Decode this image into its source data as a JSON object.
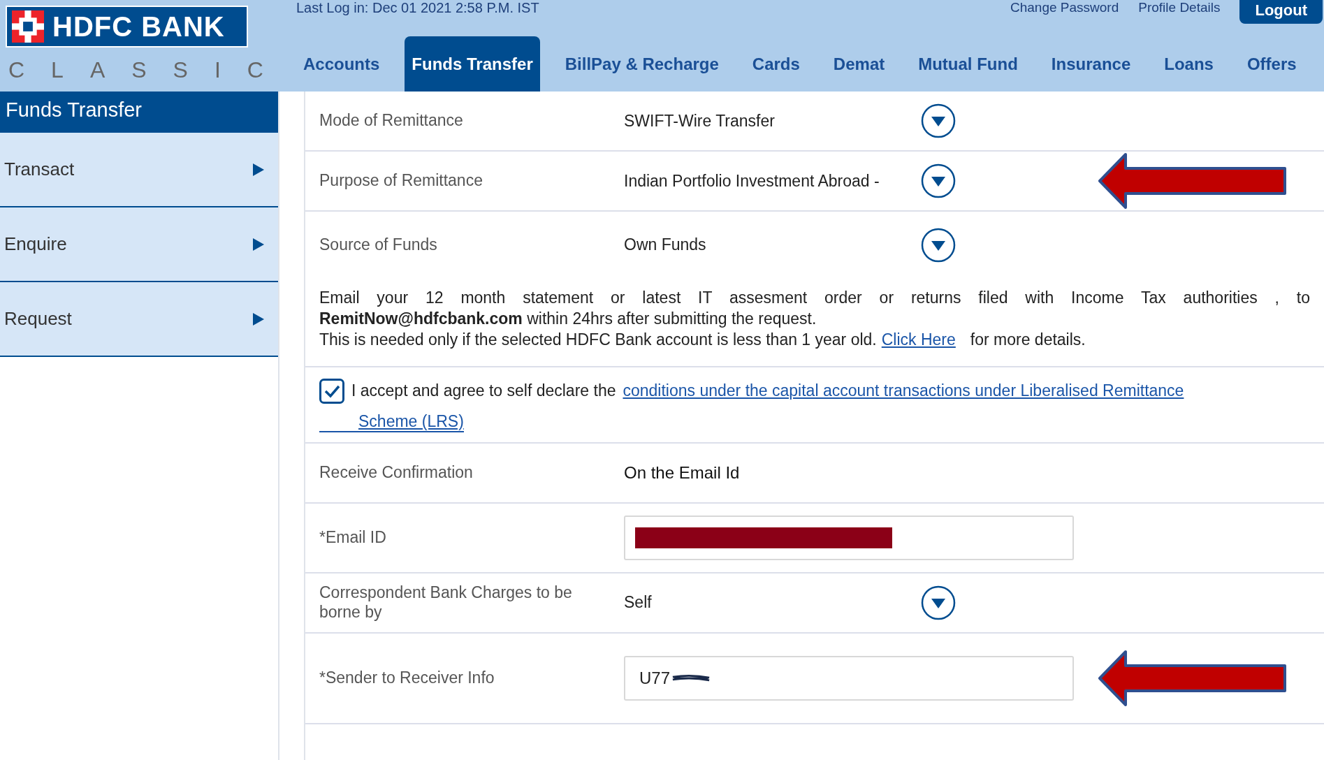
{
  "header": {
    "logo_text": "HDFC BANK",
    "sub_brand": "CLASSIC",
    "last_login": "Last Log in: Dec 01 2021 2:58 P.M. IST",
    "top_links": [
      "Change Password",
      "Profile Details"
    ],
    "logout_button": "Logout"
  },
  "nav_tabs": [
    {
      "label": "Accounts",
      "selected": false
    },
    {
      "label": "Funds Transfer",
      "selected": true
    },
    {
      "label": "BillPay & Recharge",
      "selected": false
    },
    {
      "label": "Cards",
      "selected": false
    },
    {
      "label": "Demat",
      "selected": false
    },
    {
      "label": "Mutual Fund",
      "selected": false
    },
    {
      "label": "Insurance",
      "selected": false
    },
    {
      "label": "Loans",
      "selected": false
    },
    {
      "label": "Offers",
      "selected": false
    }
  ],
  "sidebar": {
    "title": "Funds Transfer",
    "items": [
      {
        "label": "Transact"
      },
      {
        "label": "Enquire"
      },
      {
        "label": "Request"
      }
    ]
  },
  "form_rows": [
    {
      "kind": "select",
      "label": "Mode of Remittance",
      "value": "SWIFT-Wire Transfer",
      "arrow": false
    },
    {
      "kind": "select",
      "label": "Purpose of Remittance",
      "value": "Indian Portfolio Investment Abroad -",
      "arrow": true
    },
    {
      "kind": "select",
      "label": "Source of Funds",
      "value": "Own Funds",
      "arrow": false
    },
    {
      "kind": "note",
      "lines": [
        "Email your 12 month statement or latest IT assesment order or returns filed with Income Tax authorities , to",
        "**RemitNow@hdfcbank.com** within 24hrs after submitting the request."
      ],
      "last_line": "This is needed only if the selected HDFC Bank account is less than 1 year old.",
      "link": "Click Here",
      "after_link": "for more details."
    },
    {
      "kind": "checkbox",
      "checked": true,
      "text": "I accept and agree to self declare the",
      "link_lines": [
        "conditions under the capital account transactions under Liberalised Remittance",
        "Scheme (LRS)"
      ]
    },
    {
      "kind": "static",
      "label": "Receive Confirmation",
      "value": "On the Email Id"
    },
    {
      "kind": "input",
      "label": "*Email ID",
      "value": "",
      "redacted": true,
      "arrow": false
    },
    {
      "kind": "select",
      "label": "Correspondent Bank Charges to be borne by",
      "value": "Self",
      "arrow": false
    },
    {
      "kind": "input",
      "label": "*Sender to Receiver Info",
      "value": "U77",
      "redacted": true,
      "arrow": true
    }
  ]
}
